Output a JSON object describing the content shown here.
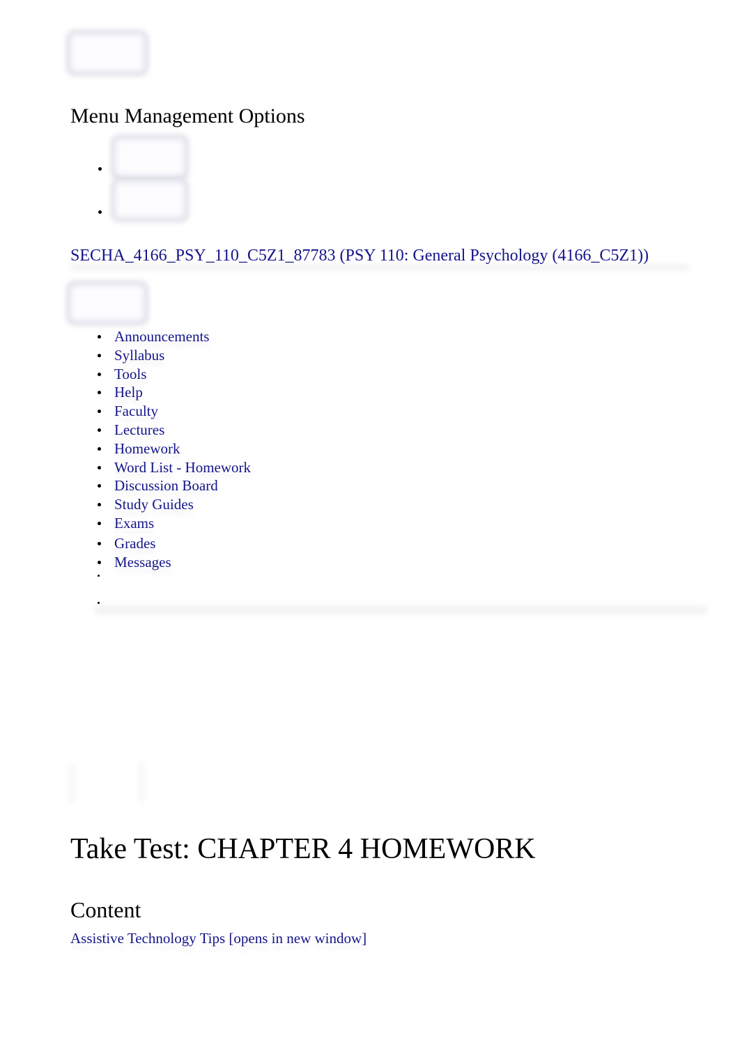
{
  "header": {
    "menu_management_title": "Menu Management Options"
  },
  "course": {
    "link_label": "SECHA_4166_PSY_110_C5Z1_87783 (PSY 110: General Psychology (4166_C5Z1))"
  },
  "nav": {
    "items": [
      {
        "label": "Announcements"
      },
      {
        "label": "Syllabus"
      },
      {
        "label": "Tools"
      },
      {
        "label": "Help"
      },
      {
        "label": "Faculty"
      },
      {
        "label": "Lectures"
      },
      {
        "label": "Homework"
      },
      {
        "label": "Word List - Homework"
      },
      {
        "label": "Discussion Board"
      },
      {
        "label": "Study Guides"
      },
      {
        "label": "Exams"
      },
      {
        "label": "Grades"
      },
      {
        "label": "Messages"
      }
    ]
  },
  "main": {
    "page_title": "Take Test: CHAPTER 4 HOMEWORK",
    "content_heading": "Content",
    "assistive_link": "Assistive Technology Tips [opens in new window]"
  },
  "colors": {
    "link": "#14148a",
    "text": "#000000",
    "background": "#ffffff"
  }
}
